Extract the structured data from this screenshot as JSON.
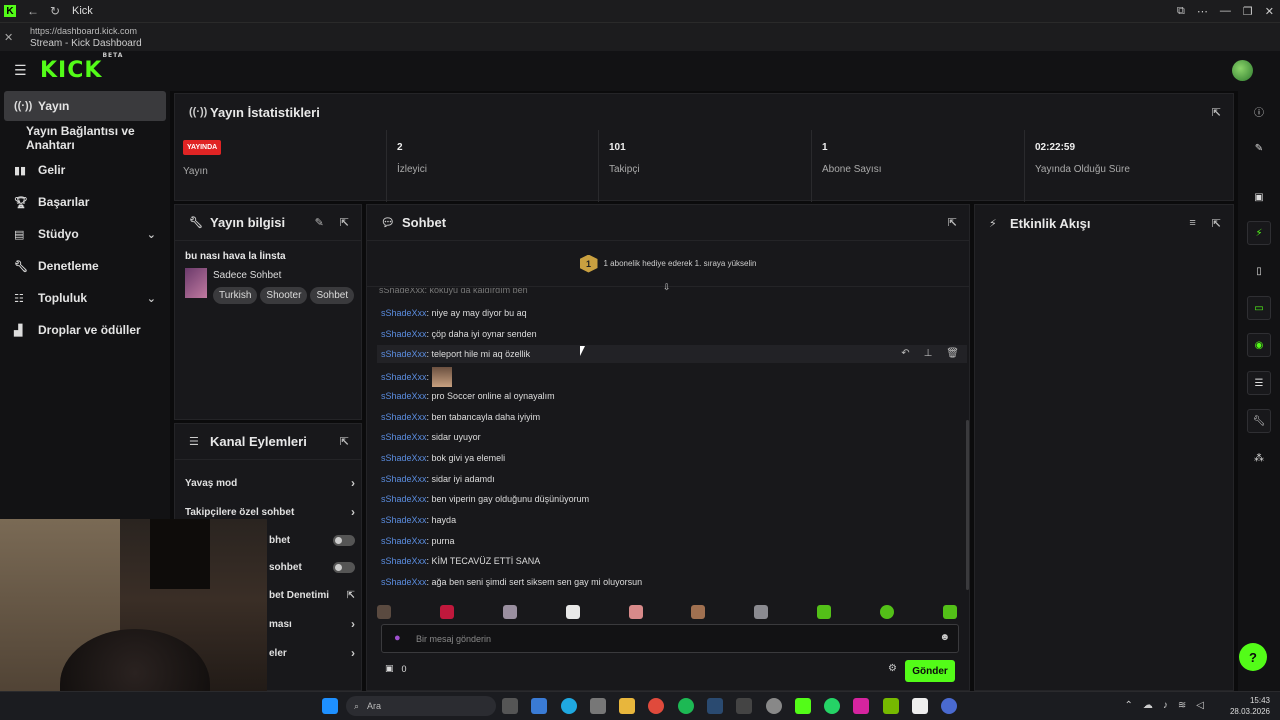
{
  "browser": {
    "tab_title": "Kick",
    "url": "https://dashboard.kick.com",
    "page_title": "Stream - Kick Dashboard"
  },
  "app": {
    "logo_text": "KICK",
    "logo_badge": "BETA",
    "accent_color": "#53fc18"
  },
  "sidebar": {
    "items": [
      {
        "label": "Yayın",
        "icon": "broadcast-icon",
        "active": true
      },
      {
        "label": "Yayın Bağlantısı ve Anahtarı"
      },
      {
        "label": "Gelir",
        "icon": "chart-icon"
      },
      {
        "label": "Başarılar",
        "icon": "trophy-icon"
      },
      {
        "label": "Stüdyo",
        "icon": "studio-icon",
        "expandable": true
      },
      {
        "label": "Denetleme",
        "icon": "wrench-icon"
      },
      {
        "label": "Topluluk",
        "icon": "community-icon",
        "expandable": true
      },
      {
        "label": "Droplar ve ödüller",
        "icon": "gift-icon"
      }
    ]
  },
  "stats": {
    "title": "Yayın İstatistikleri",
    "live_badge": "YAYINDA",
    "items": [
      {
        "value": "",
        "label": "Yayın"
      },
      {
        "value": "2",
        "label": "İzleyici"
      },
      {
        "value": "101",
        "label": "Takipçi"
      },
      {
        "value": "1",
        "label": "Abone Sayısı"
      },
      {
        "value": "02:22:59",
        "label": "Yayında Olduğu Süre"
      }
    ]
  },
  "stream_info": {
    "title": "Yayın bilgisi",
    "stream_title": "bu nası hava la İinsta",
    "category": "Sadece Sohbet",
    "tags": [
      "Turkish",
      "Shooter",
      "Sohbet"
    ]
  },
  "channel_actions": {
    "title": "Kanal Eylemleri",
    "rows": [
      "Yavaş mod",
      "Takipçilere özel sohbet",
      "bhet",
      "sohbet",
      "bet Denetimi",
      "ması",
      "eler"
    ]
  },
  "chat": {
    "title": "Sohbet",
    "banner": "1 abonelik hediye ederek 1. sıraya yükselin",
    "banner_rank": "1",
    "partial_top": "sShadeXxx: kokuyu da kaldırdım ben",
    "messages": [
      {
        "user": "sShadeXxx",
        "text": "niye ay may diyor bu aq"
      },
      {
        "user": "sShadeXxx",
        "text": "çöp daha iyi oynar senden"
      },
      {
        "user": "sShadeXxx",
        "text": "teleport hile mi aq özellik"
      },
      {
        "user": "sShadeXxx",
        "text": ""
      },
      {
        "user": "sShadeXxx",
        "text": "pro Soccer online al oynayalım"
      },
      {
        "user": "sShadeXxx",
        "text": "ben tabancayla daha iyiyim"
      },
      {
        "user": "sShadeXxx",
        "text": "sidar uyuyor"
      },
      {
        "user": "sShadeXxx",
        "text": "bok givi ya elemeli"
      },
      {
        "user": "sShadeXxx",
        "text": "sidar iyi adamdı"
      },
      {
        "user": "sShadeXxx",
        "text": "ben viperin gay olduğunu düşünüyorum"
      },
      {
        "user": "sShadeXxx",
        "text": "hayda"
      },
      {
        "user": "sShadeXxx",
        "text": "purna"
      },
      {
        "user": "sShadeXxx",
        "text": "KİM TECAVÜZ ETTİ SANA"
      },
      {
        "user": "sShadeXxx",
        "text": "ağa ben seni şimdi sert siksem sen gay mi oluyorsun"
      }
    ],
    "input_placeholder": "Bir mesaj gönderin",
    "points": "0",
    "send_label": "Gönder"
  },
  "activity": {
    "title": "Etkinlik Akışı"
  },
  "taskbar": {
    "search_placeholder": "Ara",
    "time": "15:43",
    "date": "28.03.2026"
  }
}
